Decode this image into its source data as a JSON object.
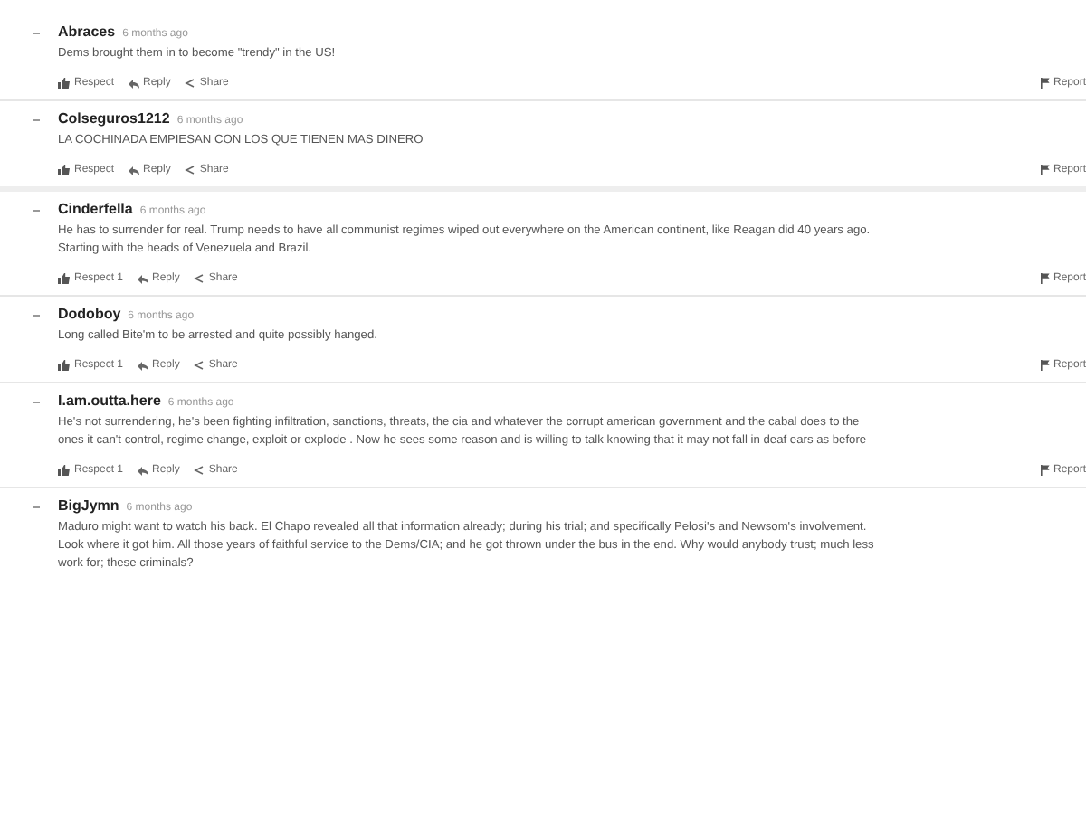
{
  "comments": [
    {
      "author": "Abraces",
      "time": "6 months ago",
      "lines": [
        "Dems brought them in to become \"trendy\" in the US!"
      ],
      "actions": {
        "respect": "Respect",
        "reply": "Reply",
        "share": "Share",
        "report": "Report"
      }
    },
    {
      "author": "Colseguros1212",
      "time": "6 months ago",
      "lines": [
        "LA COCHINADA EMPIESAN CON LOS QUE TIENEN MAS DINERO"
      ],
      "actions": {
        "respect": "Respect",
        "reply": "Reply",
        "share": "Share",
        "report": "Report"
      }
    },
    {
      "author": "Cinderfella",
      "time": "6 months ago",
      "lines": [
        "He has to surrender for real. Trump needs to have all communist regimes wiped out everywhere on the American continent, like Reagan did 40 years ago.",
        "Starting with the heads of Venezuela and Brazil."
      ],
      "actions": {
        "respect": "Respect 1",
        "reply": "Reply",
        "share": "Share",
        "report": "Report"
      }
    },
    {
      "author": "Dodoboy",
      "time": "6 months ago",
      "lines": [
        "Long called Bite'm to be arrested and quite possibly hanged."
      ],
      "actions": {
        "respect": "Respect 1",
        "reply": "Reply",
        "share": "Share",
        "report": "Report"
      }
    },
    {
      "author": "I.am.outta.here",
      "time": "6 months ago",
      "lines": [
        "He's not surrendering, he's been fighting infiltration, sanctions, threats, the cia and whatever the corrupt american government and the cabal does to the",
        "ones it can't control, regime change, exploit or explode . Now he sees some reason and is willing to talk knowing that it may not fall in deaf ears as before"
      ],
      "actions": {
        "respect": "Respect 1",
        "reply": "Reply",
        "share": "Share",
        "report": "Report"
      }
    },
    {
      "author": "BigJymn",
      "time": "6 months ago",
      "lines": [
        "Maduro might want to watch his back. El Chapo revealed all that information already; during his trial; and specifically Pelosi's and Newsom's involvement.",
        "Look where it got him. All those years of faithful service to the Dems/CIA; and he got thrown under the bus in the end. Why would anybody trust; much less",
        "work for; these criminals?"
      ]
    }
  ]
}
